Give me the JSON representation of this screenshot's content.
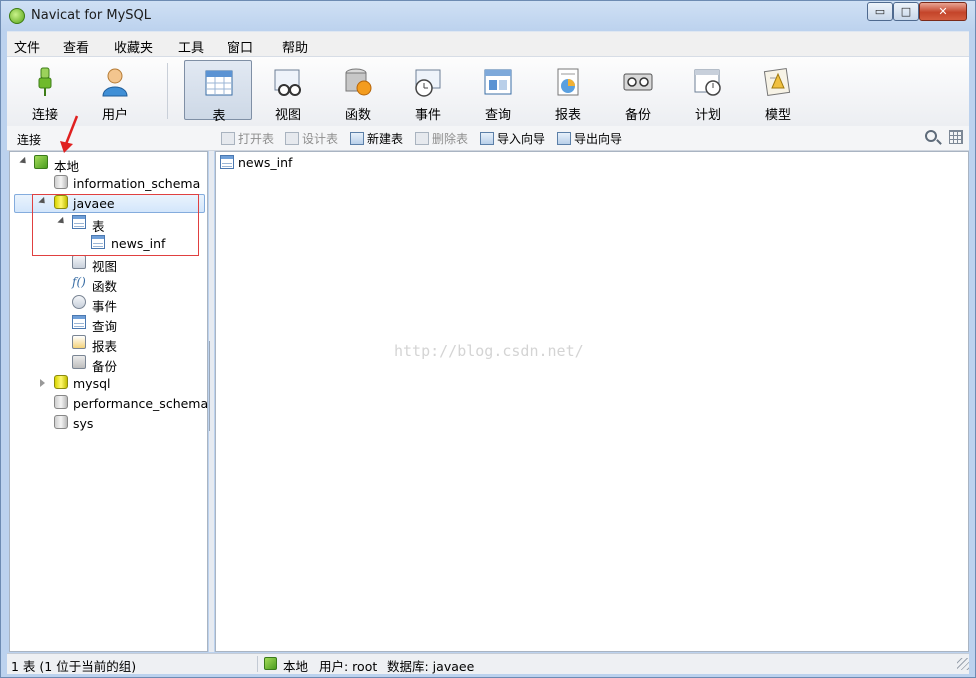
{
  "window": {
    "title": "Navicat for MySQL",
    "controls": {
      "minimize": "▭",
      "maximize": "□",
      "close": "✕"
    }
  },
  "menu": [
    {
      "label": "文件"
    },
    {
      "label": "查看"
    },
    {
      "label": "收藏夹"
    },
    {
      "label": "工具"
    },
    {
      "label": "窗口"
    },
    {
      "label": "帮助"
    }
  ],
  "toolbar": [
    {
      "label": "连接",
      "icon": "connection-icon",
      "active": false
    },
    {
      "label": "用户",
      "icon": "user-icon",
      "active": false
    },
    {
      "label": "表",
      "icon": "table-icon",
      "active": true
    },
    {
      "label": "视图",
      "icon": "view-icon",
      "active": false
    },
    {
      "label": "函数",
      "icon": "function-icon",
      "active": false
    },
    {
      "label": "事件",
      "icon": "event-icon",
      "active": false
    },
    {
      "label": "查询",
      "icon": "query-icon",
      "active": false
    },
    {
      "label": "报表",
      "icon": "report-icon",
      "active": false
    },
    {
      "label": "备份",
      "icon": "backup-icon",
      "active": false
    },
    {
      "label": "计划",
      "icon": "schedule-icon",
      "active": false
    },
    {
      "label": "模型",
      "icon": "model-icon",
      "active": false
    }
  ],
  "subbar": {
    "title": "连接",
    "actions": [
      {
        "label": "打开表",
        "enabled": false
      },
      {
        "label": "设计表",
        "enabled": false
      },
      {
        "label": "新建表",
        "enabled": true
      },
      {
        "label": "删除表",
        "enabled": false
      },
      {
        "label": "导入向导",
        "enabled": true
      },
      {
        "label": "导出向导",
        "enabled": true
      }
    ]
  },
  "tree": {
    "connection": "本地",
    "databases": {
      "information_schema": "information_schema",
      "javaee": "javaee",
      "mysql": "mysql",
      "performance_schema": "performance_schema",
      "sys": "sys"
    },
    "javaee_children": {
      "tables": "表",
      "table_news_inf": "news_inf",
      "views": "视图",
      "functions": "函数",
      "events": "事件",
      "queries": "查询",
      "reports": "报表",
      "backups": "备份"
    },
    "selected": "javaee"
  },
  "content": {
    "items": [
      "news_inf"
    ],
    "watermark": "http://blog.csdn.net/"
  },
  "status": {
    "count": "1 表 (1 位于当前的组)",
    "connection": "本地",
    "user": "用户: root",
    "database": "数据库: javaee"
  },
  "colors": {
    "accent": "#3a6ea5",
    "highlight_box": "#e04040"
  }
}
